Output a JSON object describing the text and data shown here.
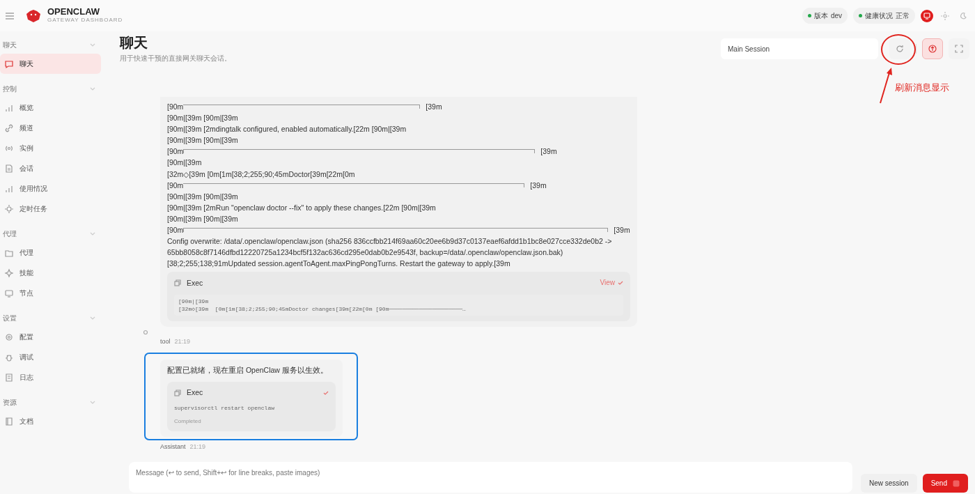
{
  "brand": {
    "name": "OPENCLAW",
    "subtitle": "GATEWAY DASHBOARD"
  },
  "status_pills": [
    {
      "label": "版本",
      "value": "dev"
    },
    {
      "label": "健康状况",
      "value": "正常"
    }
  ],
  "theme_modes": [
    {
      "selected": true
    },
    {
      "selected": false
    },
    {
      "selected": false
    }
  ],
  "sidebar": [
    {
      "title": "聊天",
      "expanded": true,
      "items": [
        {
          "label": "聊天",
          "selected": true
        }
      ]
    },
    {
      "title": "控制",
      "expanded": true,
      "items": [
        {
          "label": "概览",
          "selected": false
        },
        {
          "label": "频道",
          "selected": false
        },
        {
          "label": "实例",
          "selected": false
        },
        {
          "label": "会话",
          "selected": false
        },
        {
          "label": "使用情况",
          "selected": false
        },
        {
          "label": "定时任务",
          "selected": false
        }
      ]
    },
    {
      "title": "代理",
      "expanded": true,
      "items": [
        {
          "label": "代理",
          "selected": false
        },
        {
          "label": "技能",
          "selected": false
        },
        {
          "label": "节点",
          "selected": false
        }
      ]
    },
    {
      "title": "设置",
      "expanded": true,
      "items": [
        {
          "label": "配置",
          "selected": false
        },
        {
          "label": "调试",
          "selected": false
        },
        {
          "label": "日志",
          "selected": false
        }
      ]
    },
    {
      "title": "资源",
      "expanded": true,
      "items": [
        {
          "label": "文档",
          "selected": false
        }
      ]
    }
  ],
  "page": {
    "title": "聊天",
    "subtitle": "用于快速干预的直接网关聊天会话。"
  },
  "session_select": {
    "value": "Main Session"
  },
  "tool_output": {
    "lines": [
      {
        "kind": "rule",
        "lead": "[90m",
        "tail": "[39m",
        "tick": false
      },
      {
        "kind": "text",
        "text": "[90m|[39m [90m|[39m"
      },
      {
        "kind": "text",
        "text": "[90m|[39m [2mdingtalk configured, enabled automatically.[22m [90m|[39m"
      },
      {
        "kind": "text",
        "text": "[90m|[39m [90m|[39m"
      },
      {
        "kind": "rule",
        "lead": "[90m",
        "tail": "[39m",
        "tick": true
      },
      {
        "kind": "text",
        "text": "[90m|[39m"
      },
      {
        "kind": "text",
        "text": "[32m◇[39m [0m[1m[38;2;255;90;45mDoctor[39m[22m[0m"
      },
      {
        "kind": "rule",
        "lead": "[90m",
        "tail": "[39m",
        "tick": false
      },
      {
        "kind": "text",
        "text": "[90m|[39m [90m|[39m"
      },
      {
        "kind": "text",
        "text": "[90m|[39m [2mRun \"openclaw doctor --fix\" to apply these changes.[22m [90m|[39m"
      },
      {
        "kind": "text",
        "text": "[90m|[39m [90m|[39m"
      },
      {
        "kind": "rule",
        "lead": "[90m",
        "tail": "[39m",
        "tick": true
      },
      {
        "kind": "text",
        "text": "Config overwrite: /data/.openclaw/openclaw.json (sha256 836ccfbb214f69aa60c20ee6b9d37c0137eaef6afdd1b1bc8e027cce332de0b2 -> 65bb8058c8f7146dfbd12220725a1234bcf5f132ac636cd295e0dab0b2e9543f, backup=/data/.openclaw/openclaw.json.bak)"
      },
      {
        "kind": "text",
        "text": "[38;2;255;138;91mUpdated session.agentToAgent.maxPingPongTurns. Restart the gateway to apply.[39m"
      }
    ],
    "exec": {
      "title": "Exec",
      "action": "View",
      "output": [
        "[90m|[39m",
        "[32m◇[39m  [0m[1m[38;2;255;90;45mDoctor changes[39m[22m[0m [90m──────────────────────…"
      ]
    }
  },
  "tool_meta": {
    "sender": "tool",
    "time": "21:19"
  },
  "assistant_message": {
    "text": "配置已就绪，现在重启 OpenClaw 服务以生效。",
    "exec": {
      "title": "Exec",
      "command": "supervisorctl restart openclaw",
      "status": "Completed",
      "done": true
    }
  },
  "assistant_meta": {
    "sender": "Assistant",
    "time": "21:19"
  },
  "composer": {
    "placeholder": "Message (↩ to send, Shift+↩ for line breaks, paste images)",
    "new_session": "New session",
    "send": "Send"
  },
  "annotations": {
    "callout": "刷新消息显示"
  }
}
